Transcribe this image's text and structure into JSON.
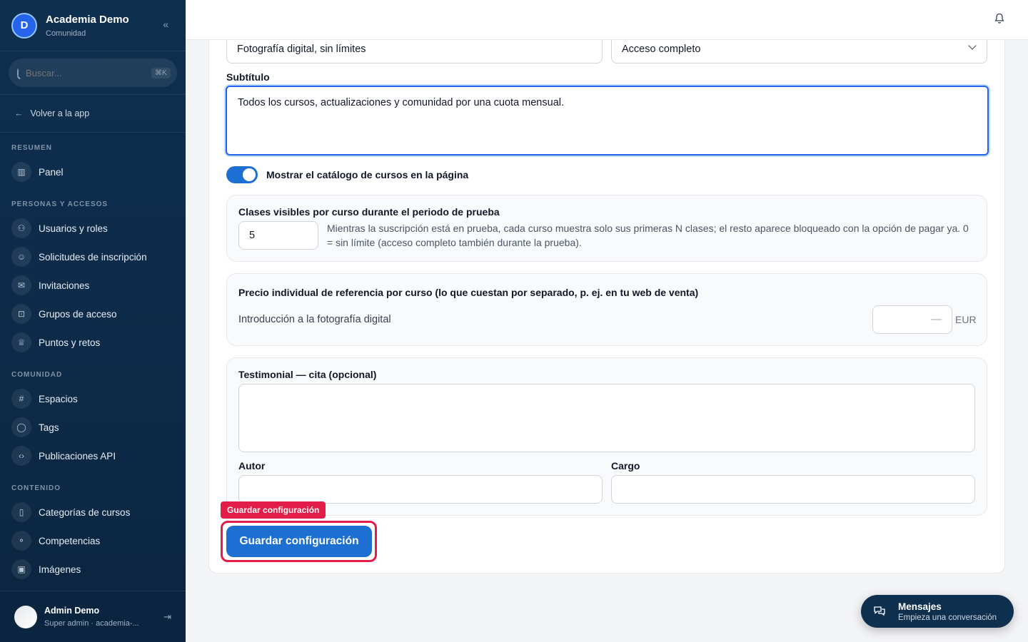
{
  "sidebar": {
    "brand_title": "Academia Demo",
    "brand_subtitle": "Comunidad",
    "brand_logo": "D",
    "search_placeholder": "Buscar...",
    "search_shortcut": "⌘K",
    "back_label": "Volver a la app",
    "sections": [
      {
        "title": "RESUMEN",
        "items": [
          {
            "label": "Panel",
            "icon": "chart-icon"
          }
        ]
      },
      {
        "title": "PERSONAS Y ACCESOS",
        "items": [
          {
            "label": "Usuarios y roles",
            "icon": "users-icon"
          },
          {
            "label": "Solicitudes de inscripción",
            "icon": "user-icon"
          },
          {
            "label": "Invitaciones",
            "icon": "mail-icon"
          },
          {
            "label": "Grupos de acceso",
            "icon": "lock-icon"
          },
          {
            "label": "Puntos y retos",
            "icon": "trophy-icon"
          }
        ]
      },
      {
        "title": "COMUNIDAD",
        "items": [
          {
            "label": "Espacios",
            "icon": "hash-icon"
          },
          {
            "label": "Tags",
            "icon": "chat-icon"
          },
          {
            "label": "Publicaciones API",
            "icon": "code-icon"
          }
        ]
      },
      {
        "title": "CONTENIDO",
        "items": [
          {
            "label": "Categorías de cursos",
            "icon": "book-icon"
          },
          {
            "label": "Competencias",
            "icon": "badge-icon"
          },
          {
            "label": "Imágenes",
            "icon": "image-icon"
          }
        ]
      }
    ],
    "user_name": "Admin Demo",
    "user_role": "Super admin · academia-..."
  },
  "form": {
    "title_value": "Fotografía digital, sin límites",
    "access_value": "Acceso completo",
    "subtitle_label": "Subtítulo",
    "subtitle_value": "Todos los cursos, actualizaciones y comunidad por una cuota mensual.",
    "toggle_label": "Mostrar el catálogo de cursos en la página",
    "toggle_on": true,
    "trial_label": "Clases visibles por curso durante el periodo de prueba",
    "trial_value": "5",
    "trial_help": "Mientras la suscripción está en prueba, cada curso muestra solo sus primeras N clases; el resto aparece bloqueado con la opción de pagar ya. 0 = sin límite (acceso completo también durante la prueba).",
    "price_label": "Precio individual de referencia por curso (lo que cuestan por separado, p. ej. en tu web de venta)",
    "price_course": "Introducción a la fotografía digital",
    "price_placeholder": "—",
    "price_currency": "EUR",
    "testimonial_label": "Testimonial — cita (opcional)",
    "author_label": "Autor",
    "role_label": "Cargo",
    "save_tooltip": "Guardar configuración",
    "save_label": "Guardar configuración"
  },
  "messages": {
    "title": "Mensajes",
    "subtitle": "Empieza una conversación"
  },
  "colors": {
    "sidebar_bg": "#0f2f4f",
    "accent": "#1d6fd1",
    "highlight": "#e11d48"
  }
}
